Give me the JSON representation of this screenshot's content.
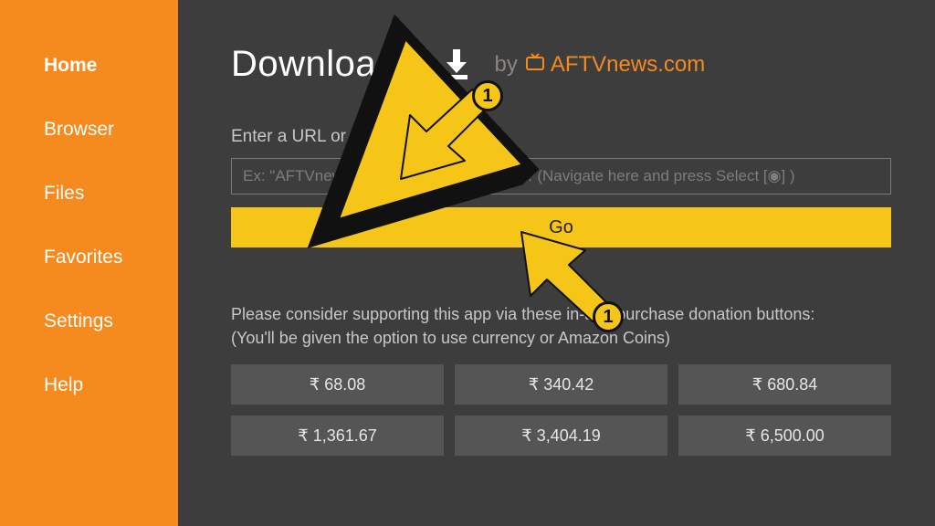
{
  "sidebar": {
    "items": [
      {
        "label": "Home",
        "active": true
      },
      {
        "label": "Browser",
        "active": false
      },
      {
        "label": "Files",
        "active": false
      },
      {
        "label": "Favorites",
        "active": false
      },
      {
        "label": "Settings",
        "active": false
      },
      {
        "label": "Help",
        "active": false
      }
    ]
  },
  "header": {
    "title": "Downloader",
    "by": "by",
    "brand": "AFTVnews.com"
  },
  "main": {
    "prompt": "Enter a URL or Search Term:",
    "url_value": "",
    "url_placeholder": "Ex: \"AFTVnews.com\" or \"Fire TV News\"… (Navigate here and press Select [◉] )",
    "go_label": "Go",
    "support_line1": "Please consider supporting this app via these in-app purchase donation buttons:",
    "support_line2": "(You'll be given the option to use currency or Amazon Coins)"
  },
  "donations": [
    "₹ 68.08",
    "₹ 340.42",
    "₹ 680.84",
    "₹ 1,361.67",
    "₹ 3,404.19",
    "₹ 6,500.00"
  ],
  "annotations": {
    "arrow1_label": "1",
    "arrow2_label": "1"
  },
  "colors": {
    "accent": "#f58a1f",
    "go": "#f5c518",
    "bg": "#3d3d3d"
  }
}
